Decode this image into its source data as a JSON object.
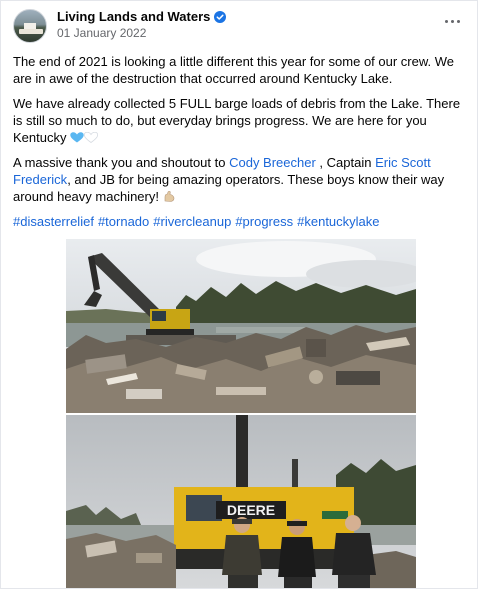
{
  "post": {
    "page_name": "Living Lands and Waters",
    "date": "01 January 2022",
    "paragraphs": {
      "p1": "The end of 2021 is looking a little different this year for some of our crew. We are in awe of the destruction that occurred around Kentucky Lake.",
      "p2_text": "We have already collected 5 FULL barge loads of debris from the Lake. There is still so much to do, but everyday brings progress. We are here for you Kentucky",
      "p3_before": "A massive thank you and shoutout to ",
      "p3_link1": "Cody Breecher",
      "p3_mid": " , Captain ",
      "p3_link2": "Eric Scott Frederick",
      "p3_after": ", and JB for being amazing operators. These boys know their way around heavy machinery!"
    },
    "hashtags": [
      "#disasterrelief",
      "#tornado",
      "#rivercleanup",
      "#progress",
      "#kentuckylake"
    ],
    "photo2_sign": "DEERE"
  },
  "colors": {
    "link": "#1a66d8",
    "meta": "#65676b",
    "verified": "#1b74e4"
  },
  "icons": {
    "verified": "verified-badge-icon",
    "more": "more-options-icon",
    "heart_blue": "blue-heart-emoji",
    "heart_white": "white-heart-emoji",
    "muscle": "flexed-biceps-emoji"
  }
}
